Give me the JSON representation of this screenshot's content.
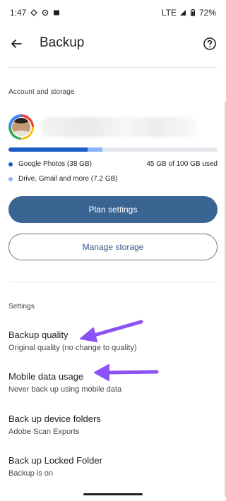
{
  "status_bar": {
    "time": "1:47",
    "network": "LTE",
    "battery": "72%"
  },
  "header": {
    "title": "Backup",
    "back_icon": "arrow-back-icon",
    "help_icon": "help-icon"
  },
  "account": {
    "section_label": "Account and storage",
    "storage": {
      "photos_fraction": 0.38,
      "drive_fraction": 0.072,
      "used_text": "45 GB of 100 GB used",
      "photos_label": "Google Photos (38 GB)",
      "drive_label": "Drive, Gmail and more (7.2 GB)"
    },
    "plan_button": "Plan settings",
    "manage_button": "Manage storage"
  },
  "settings": {
    "section_label": "Settings",
    "items": [
      {
        "title": "Backup quality",
        "subtitle": "Original quality (no change to quality)"
      },
      {
        "title": "Mobile data usage",
        "subtitle": "Never back up using mobile data"
      },
      {
        "title": "Back up device folders",
        "subtitle": "Adobe Scan Exports"
      },
      {
        "title": "Back up Locked Folder",
        "subtitle": "Backup is on"
      }
    ]
  },
  "colors": {
    "accent": "#3a6593",
    "photos_bar": "#1a5cc8",
    "drive_bar": "#8ab4f8",
    "annotation_arrow": "#8c52f5"
  }
}
